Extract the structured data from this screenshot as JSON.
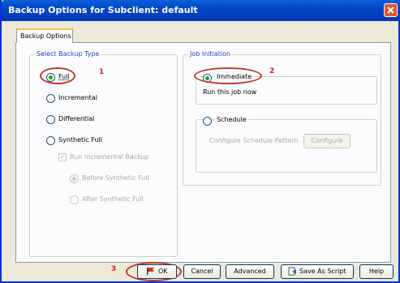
{
  "window": {
    "title": "Backup Options for Subclient: default"
  },
  "tab": {
    "label": "Backup Options"
  },
  "backup_type": {
    "legend": "Select Backup Type",
    "options": [
      "Full",
      "Incremental",
      "Differential",
      "Synthetic Full"
    ],
    "selected": "Full",
    "run_incremental_label": "Run Incremental Backup",
    "run_incremental_checked": true,
    "before_label": "Before Synthetic Full",
    "after_label": "After Synthetic Full"
  },
  "job_initiation": {
    "legend": "Job Initiation",
    "immediate_label": "Immediate",
    "immediate_desc": "Run this job now",
    "schedule_label": "Schedule",
    "schedule_desc": "Configure Schedule Pattern",
    "configure_label": "Configure",
    "selected": "Immediate"
  },
  "buttons": {
    "ok": "OK",
    "cancel": "Cancel",
    "advanced": "Advanced",
    "save_script": "Save As Script",
    "help": "Help"
  },
  "callouts": [
    "1",
    "2",
    "3"
  ],
  "colors": {
    "title_bar": "#0a5fd8",
    "callout": "#d02020",
    "selected_radio": "#21a121"
  }
}
